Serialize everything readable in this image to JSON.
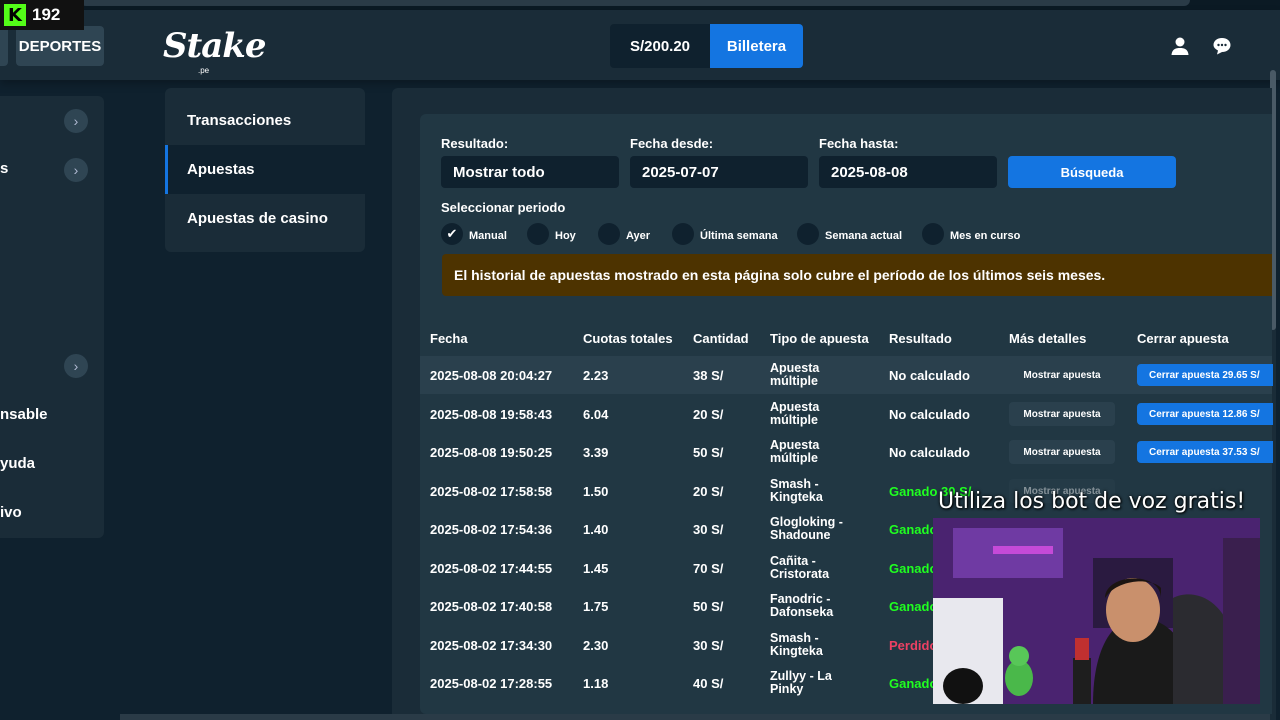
{
  "stream": {
    "viewer_count": "192",
    "overlay_text": "Utiliza los bot de voz gratis!"
  },
  "header": {
    "deportes_label": "DEPORTES",
    "logo_text": "Stake",
    "logo_sub": ".pe",
    "balance": "S/200.20",
    "wallet_label": "Billetera",
    "icons": [
      "user-icon",
      "chat-icon"
    ]
  },
  "sidebar": {
    "items": [
      {
        "label": "s"
      },
      {
        "label": "nsable"
      },
      {
        "label": "yuda"
      },
      {
        "label": "ivo"
      }
    ]
  },
  "leftnav": {
    "items": [
      {
        "label": "Transacciones",
        "active": false
      },
      {
        "label": "Apuestas",
        "active": true
      },
      {
        "label": "Apuestas de casino",
        "active": false
      }
    ]
  },
  "filters": {
    "resultado_label": "Resultado:",
    "resultado_value": "Mostrar todo",
    "desde_label": "Fecha desde:",
    "desde_value": "2025-07-07",
    "hasta_label": "Fecha hasta:",
    "hasta_value": "2025-08-08",
    "search_label": "Búsqueda",
    "period_title": "Seleccionar periodo",
    "periods": [
      "Manual",
      "Hoy",
      "Ayer",
      "Última semana",
      "Semana actual",
      "Mes en curso"
    ]
  },
  "notice": "El historial de apuestas mostrado en esta página solo cubre el período de los últimos seis meses.",
  "table": {
    "headers": [
      "Fecha",
      "Cuotas totales",
      "Cantidad",
      "Tipo de apuesta",
      "Resultado",
      "Más detalles",
      "Cerrar apuesta"
    ],
    "show_label": "Mostrar apuesta",
    "rows": [
      {
        "fecha": "2025-08-08 20:04:27",
        "cuotas": "2.23",
        "cantidad": "38 S/",
        "tipo1": "Apuesta",
        "tipo2": "múltiple",
        "resultado": "No calculado",
        "cerrar": "Cerrar apuesta  29.65 S/"
      },
      {
        "fecha": "2025-08-08 19:58:43",
        "cuotas": "6.04",
        "cantidad": "20 S/",
        "tipo1": "Apuesta",
        "tipo2": "múltiple",
        "resultado": "No calculado",
        "cerrar": "Cerrar apuesta  12.86 S/"
      },
      {
        "fecha": "2025-08-08 19:50:25",
        "cuotas": "3.39",
        "cantidad": "50 S/",
        "tipo1": "Apuesta",
        "tipo2": "múltiple",
        "resultado": "No calculado",
        "cerrar": "Cerrar apuesta  37.53 S/"
      },
      {
        "fecha": "2025-08-02 17:58:58",
        "cuotas": "1.50",
        "cantidad": "20 S/",
        "tipo1": "Smash -",
        "tipo2": "Kingteka",
        "resultado": "Ganado 30 S/"
      },
      {
        "fecha": "2025-08-02 17:54:36",
        "cuotas": "1.40",
        "cantidad": "30 S/",
        "tipo1": "Glogloking -",
        "tipo2": "Shadoune",
        "resultado": "Ganado"
      },
      {
        "fecha": "2025-08-02 17:44:55",
        "cuotas": "1.45",
        "cantidad": "70 S/",
        "tipo1": "Cañita -",
        "tipo2": "Cristorata",
        "resultado": "Ganado"
      },
      {
        "fecha": "2025-08-02 17:40:58",
        "cuotas": "1.75",
        "cantidad": "50 S/",
        "tipo1": "Fanodric -",
        "tipo2": "Dafonseka",
        "resultado": "Ganado"
      },
      {
        "fecha": "2025-08-02 17:34:30",
        "cuotas": "2.30",
        "cantidad": "30 S/",
        "tipo1": "Smash -",
        "tipo2": "Kingteka",
        "resultado": "Perdido"
      },
      {
        "fecha": "2025-08-02 17:28:55",
        "cuotas": "1.18",
        "cantidad": "40 S/",
        "tipo1": "Zullyy - La",
        "tipo2": "Pinky",
        "resultado": "Ganado"
      }
    ]
  },
  "colors": {
    "accent": "#1475e1",
    "win": "#1fff20",
    "loss": "#ed4163",
    "notice_bg": "#4d3300"
  }
}
